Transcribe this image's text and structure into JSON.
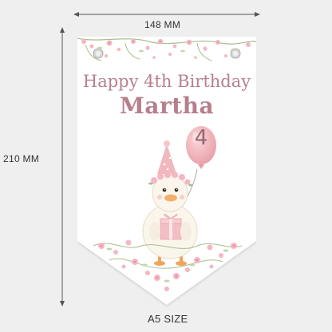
{
  "dimensions": {
    "width_label": "148 MM",
    "height_label": "210 MM",
    "size_label": "A5 SIZE"
  },
  "banner": {
    "line1": "Happy 4th Birthday",
    "line2": "Martha",
    "balloon_number": "4",
    "illustration": "duck-with-party-hat-gift-and-balloon",
    "colors": {
      "text": "#b77f8c",
      "balloon": "#f0b5ba",
      "flowers": "#f4b7c4",
      "leaves": "#a8be8e",
      "background": "#ffffff",
      "page": "#efefef"
    }
  }
}
